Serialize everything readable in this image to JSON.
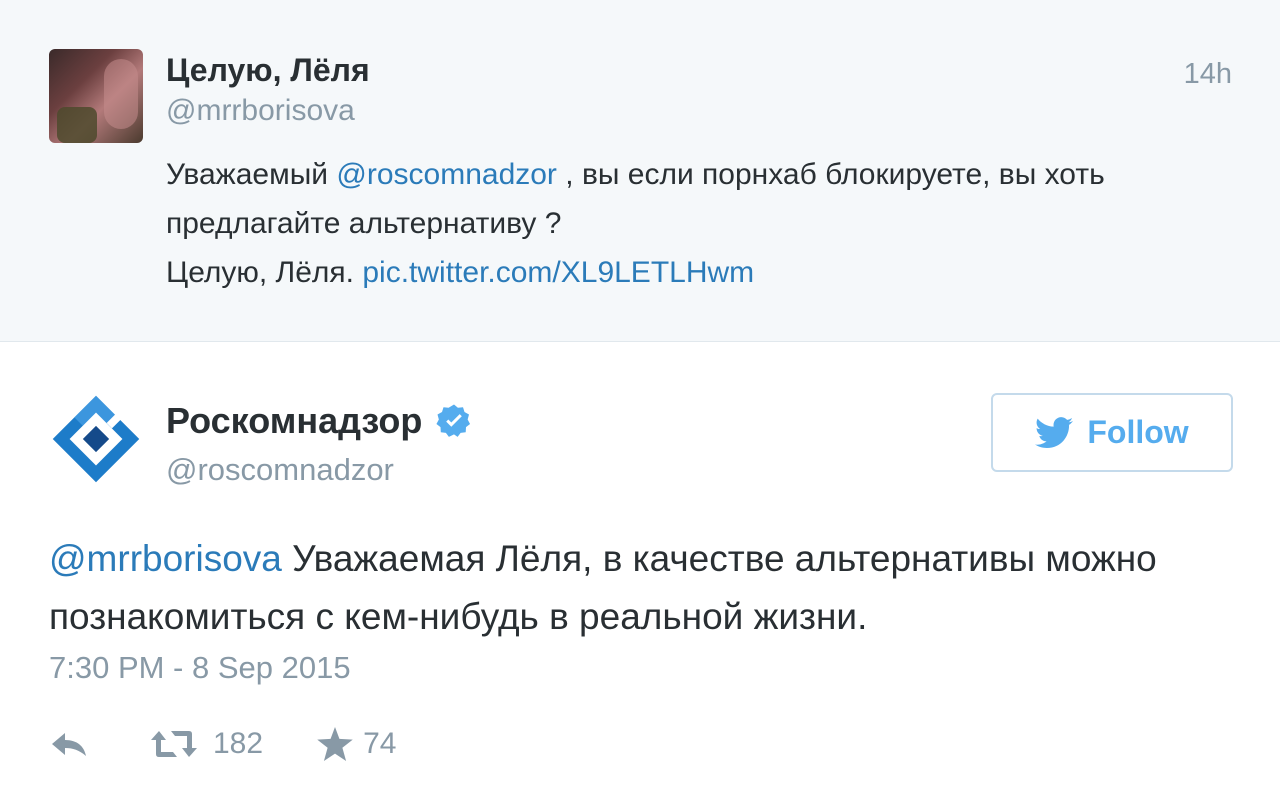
{
  "colors": {
    "link": "#2b7bb9",
    "accent": "#55acee",
    "muted": "#8899a6",
    "text": "#292f33",
    "verified": "#55acee",
    "logo_blue": "#1d7cc9",
    "logo_dark": "#154a8a"
  },
  "original_tweet": {
    "name": "Целую, Лёля",
    "handle": "@mrrborisova",
    "time": "14h",
    "text_1": "Уважаемый ",
    "mention": "@roscomnadzor",
    "text_2": " , вы если порнхаб блокируете, вы хоть предлагайте альтернативу ?",
    "text_3": "Целую, Лёля. ",
    "pic_link": "pic.twitter.com/XL9LETLHwm"
  },
  "reply_tweet": {
    "name": "Роскомнадзор",
    "handle": "@roscomnadzor",
    "follow_label": "Follow",
    "mention": "@mrrborisova",
    "text": " Уважаемая Лёля, в качестве альтернативы можно познакомиться с кем-нибудь в реальной жизни.",
    "date": "7:30 PM - 8 Sep 2015",
    "retweets": "182",
    "favorites": "74",
    "icons": [
      "reply-icon",
      "retweet-icon",
      "star-icon",
      "verified-icon",
      "twitter-bird-icon"
    ]
  }
}
